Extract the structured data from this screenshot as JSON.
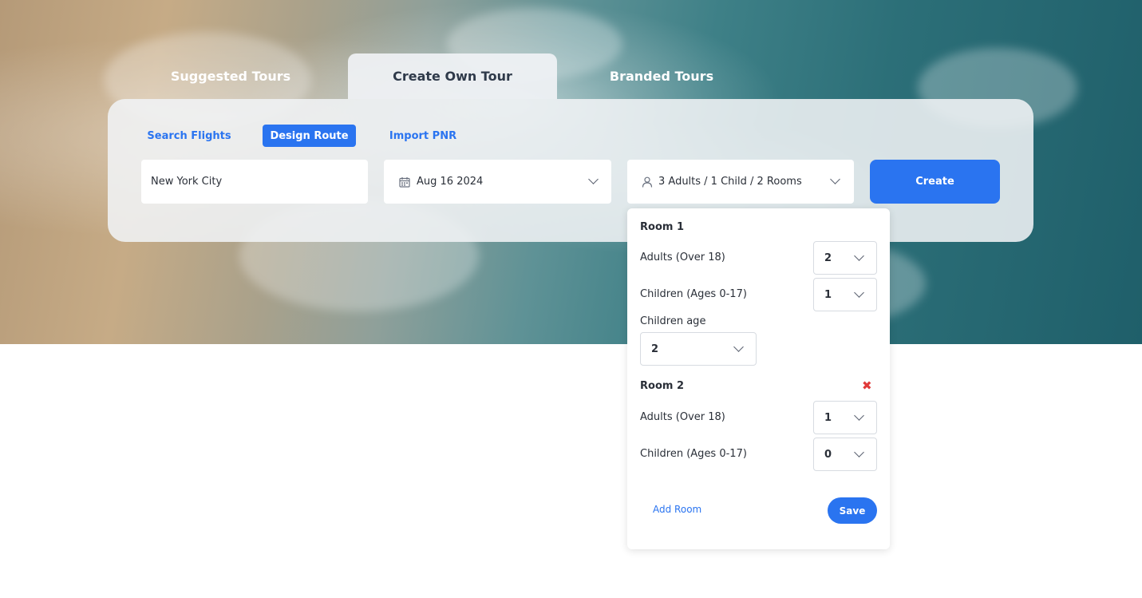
{
  "tabs": [
    {
      "label": "Suggested Tours",
      "active": false
    },
    {
      "label": "Create Own Tour",
      "active": true
    },
    {
      "label": "Branded Tours",
      "active": false
    }
  ],
  "subtabs": [
    {
      "label": "Search Flights",
      "active": false
    },
    {
      "label": "Design Route",
      "active": true
    },
    {
      "label": "Import PNR",
      "active": false
    }
  ],
  "search": {
    "destination_value": "New York City",
    "date_value": "Aug 16 2024",
    "guests_value": "3 Adults / 1 Child / 2 Rooms",
    "create_label": "Create"
  },
  "rooms_dropdown": {
    "rooms": [
      {
        "title": "Room 1",
        "adults_label": "Adults (Over 18)",
        "adults_value": "2",
        "children_label": "Children (Ages 0-17)",
        "children_value": "1",
        "children_age_label": "Children age",
        "children_age_value": "2"
      },
      {
        "title": "Room 2",
        "remove_icon": "✖",
        "adults_label": "Adults (Over 18)",
        "adults_value": "1",
        "children_label": "Children (Ages 0-17)",
        "children_value": "0"
      }
    ],
    "add_room_label": "Add Room",
    "save_label": "Save"
  },
  "colors": {
    "accent": "#2a74f0",
    "remove": "#e03a3a"
  }
}
